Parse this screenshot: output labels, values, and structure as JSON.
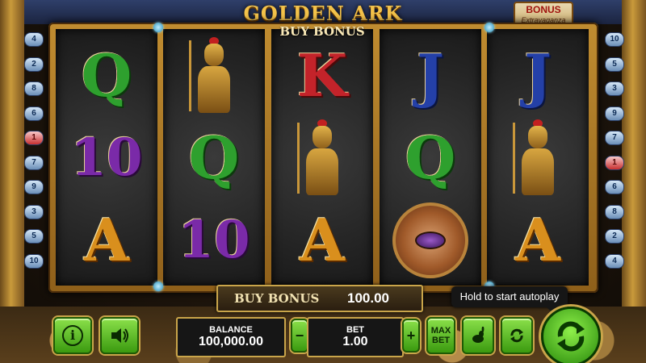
{
  "game": {
    "logo_text": "GOLDEN ARK",
    "bonus_badge": {
      "line1": "BONUS",
      "line2": "Extravaganza"
    }
  },
  "header": {
    "buy_bonus_label": "BUY BONUS"
  },
  "lines": {
    "left": [
      "4",
      "2",
      "8",
      "6",
      "1",
      "7",
      "9",
      "3",
      "5",
      "10"
    ],
    "right": [
      "10",
      "5",
      "3",
      "9",
      "7",
      "1",
      "6",
      "8",
      "2",
      "4"
    ]
  },
  "reels": [
    [
      "Q",
      "10",
      "A"
    ],
    [
      "Pharaoh Queen",
      "Q",
      "10"
    ],
    [
      "K",
      "Pharaoh Queen",
      "A"
    ],
    [
      "J",
      "Q",
      "Eye of Horus"
    ],
    [
      "J",
      "Pharaoh Queen",
      "A"
    ]
  ],
  "buy_bonus_bar": {
    "label": "BUY BONUS",
    "value": "100.00"
  },
  "tooltip": {
    "text": "Hold to start autoplay"
  },
  "controls": {
    "info_label": "i",
    "balance": {
      "label": "BALANCE",
      "value": "100,000.00"
    },
    "bet": {
      "label": "BET",
      "value": "1.00",
      "minus": "−",
      "plus": "+"
    },
    "maxbet_line1": "MAX",
    "maxbet_line2": "BET"
  },
  "colors": {
    "accent_green": "#5cc22a",
    "gold": "#c9a54a",
    "panel_bg": "#161616"
  },
  "icons": [
    "info-icon",
    "sound-icon",
    "rabbit-icon",
    "autoplay-icon",
    "spin-icon"
  ]
}
